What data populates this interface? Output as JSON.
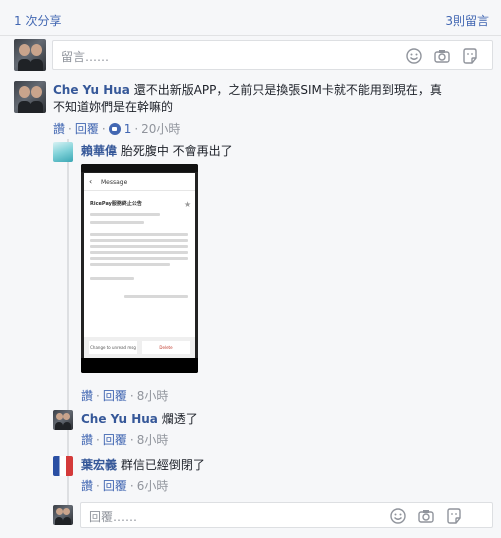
{
  "header": {
    "shares": "1 次分享",
    "comment_count": "3則留言"
  },
  "top_input": {
    "placeholder": "留言……"
  },
  "comment": {
    "author": "Che Yu Hua",
    "text_line1": "還不出新版APP，之前只是換張SIM卡就不能用到現在，真",
    "text_line2": "不知道妳們是在幹嘛的",
    "like_label": "讚",
    "reply_label": "回覆",
    "like_count": "1",
    "time": "20小時"
  },
  "replies": [
    {
      "author": "賴華偉",
      "text": "胎死腹中 不會再出了",
      "like_label": "讚",
      "reply_label": "回覆",
      "time": "8小時"
    },
    {
      "author": "Che Yu Hua",
      "text": "爛透了",
      "like_label": "讚",
      "reply_label": "回覆",
      "time": "8小時"
    },
    {
      "author": "葉宏義",
      "text": "群信已經倒閉了",
      "like_label": "讚",
      "reply_label": "回覆",
      "time": "6小時"
    }
  ],
  "screenshot": {
    "title": "Message",
    "heading": "RicePay服務終止公告",
    "btn_left": "Change to\nunread msg",
    "btn_right": "Delete"
  },
  "reply_input": {
    "placeholder": "回覆……"
  },
  "icons": [
    "emoji-icon",
    "camera-icon",
    "sticker-icon",
    "like-icon",
    "back-icon",
    "star-icon"
  ],
  "colors": {
    "link": "#4267b2",
    "name": "#365899",
    "muted": "#90949c"
  }
}
